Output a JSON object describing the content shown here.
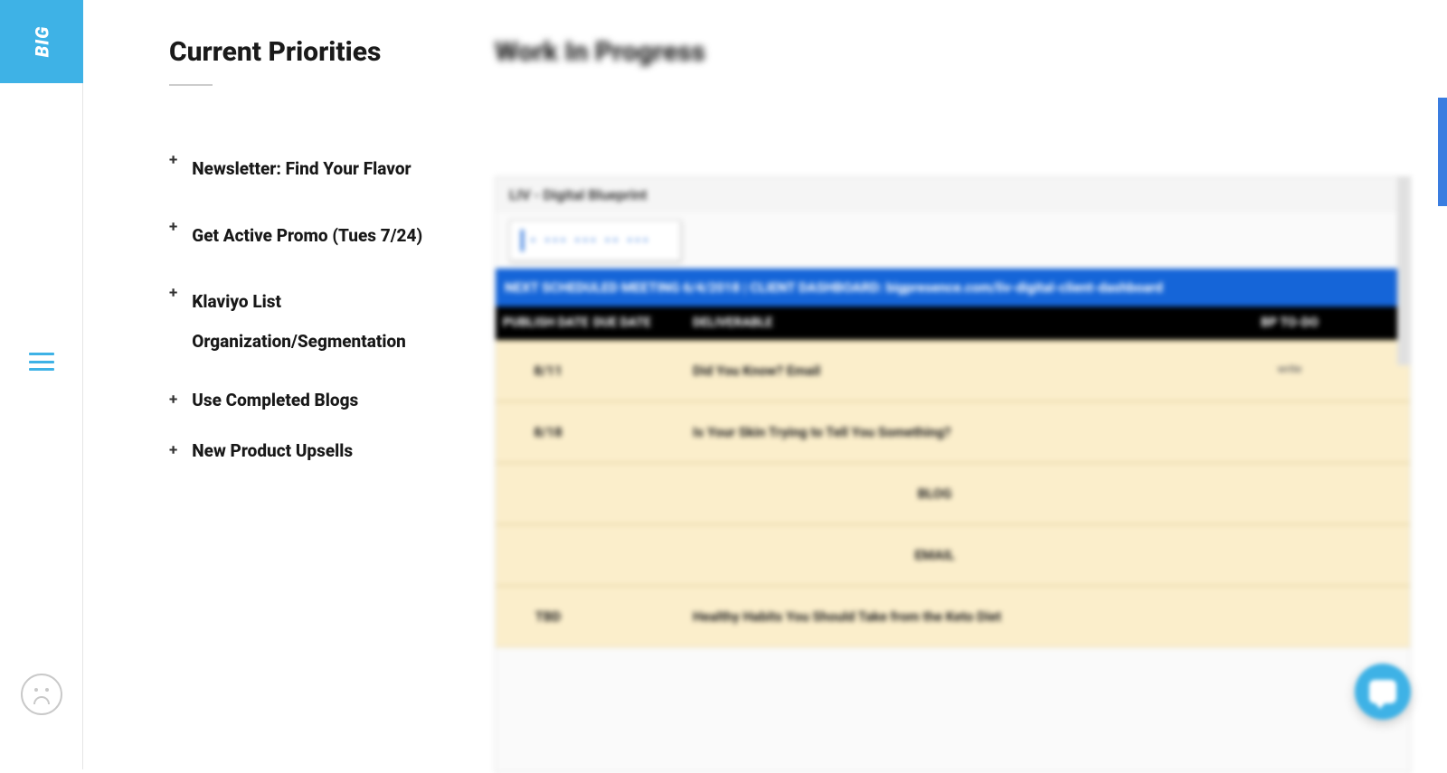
{
  "sidebar": {
    "logo_text": "BIG"
  },
  "priorities": {
    "title": "Current Priorities",
    "items": [
      {
        "label": "Newsletter: Find Your Flavor"
      },
      {
        "label": "Get Active Promo (Tues 7/24)"
      },
      {
        "label": "Klaviyo List Organization/Segmentation"
      },
      {
        "label": "Use Completed Blogs"
      },
      {
        "label": "New Product Upsells"
      }
    ]
  },
  "wip": {
    "title": "Work In Progress",
    "sheet_name": "LIV - Digital Blueprint",
    "tab_dots": "• •••  ••• •• •••",
    "banner": "NEXT SCHEDULED MEETING 6/4/2018 | CLIENT DASHBOARD: bigpresence.com/liv-digital-client-dashboard",
    "columns": {
      "publish": "PUBLISH DATE",
      "due": "DUE DATE",
      "deliverable": "DELIVERABLE",
      "todo": "BP TO-DO"
    },
    "rows": [
      {
        "date": "8/11",
        "deliverable": "Did You Know? Email",
        "todo": "write"
      },
      {
        "date": "8/18",
        "deliverable": "Is Your Skin Trying to Tell You Something?",
        "todo": ""
      },
      {
        "date": "",
        "deliverable": "BLOG",
        "todo": ""
      },
      {
        "date": "",
        "deliverable": "EMAIL",
        "todo": ""
      },
      {
        "date": "TBD",
        "deliverable": "Healthy Habits You Should Take from the Keto Diet",
        "todo": ""
      }
    ]
  }
}
